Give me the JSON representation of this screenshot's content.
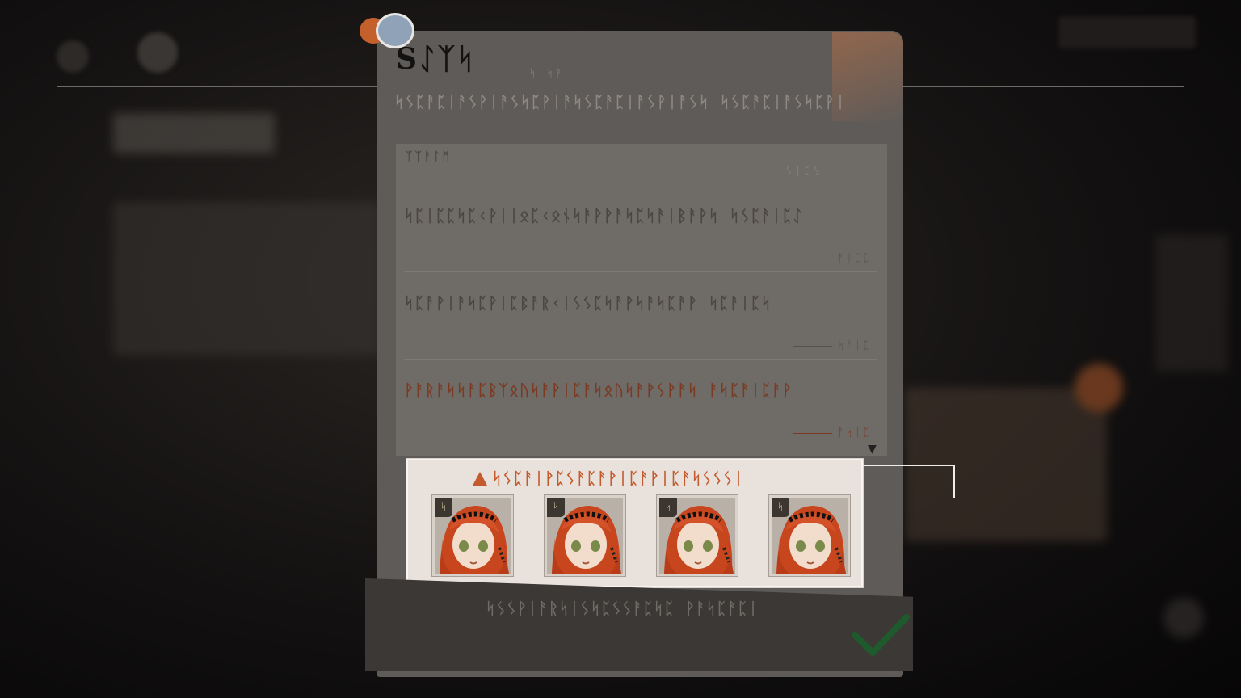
{
  "modal": {
    "title": "Sᛇᛉᛋ",
    "subtitle_tag": "ᛋᛁᛋᚹ",
    "description": "ᛋᛊᛈᚨᛈᛁᚨᛊᚹᛁᚨᛊᛋᛈᚹᛁᚨᛋᛊᛈᚨᛈᛁᚨᛊᚹᛁᚨᛊᛋ ᛋᛊᛈᚨᛈᛁᚨᛊᛋᛈᚹᛁ",
    "list_header": "ᛉᛉᚨᛚᛗ",
    "list_meta": "ᛊᛁᛈᛊ"
  },
  "missions": [
    {
      "text": "ᛋᛈᛁᛈᛈᛋᛈᚲᚹᛁᛁᛟᛈᚲᛟᚾᛋᚨᚹᚹᚨᛋᛈᛋᚨᛁᛒᚨᚹᛋ ᛋᛊᛈᚨᛁᛈᛇ",
      "progress": "ᚨᛁᛈᛈ",
      "highlight": false
    },
    {
      "text": "ᛋᛈᚨᚹᛁᚨᛋᛈᚹᛁᛈᛒᚨᚱᚲᛁᛊᛊᛈᛋᚨᚹᛋᚨᛋᛈᚨᚹ ᛋᛈᚨᛁᛈᛋ",
      "progress": "ᛋᚨᛁᛈ",
      "highlight": false
    },
    {
      "text": "ᚹᚨᚱᚨᛋᛋᚨᛈᛒᛉᛟᚢᛋᚨᚹᛁᛈᚨᛋᛟᚢᛋᚨᚹᛊᚹᚨᛋ ᚨᛋᛈᚨᛁᛈᚨᚹ",
      "progress": "ᚨᛋᛁᛈ",
      "highlight": true
    }
  ],
  "reward": {
    "title": "ᛋᛊᛈᚨᛁᚹᛈᛊᚨᛈᚨᚹᛁᛈᚨᚹᛁᛈᚨᛋᛊᛊᛊᛁ",
    "items": [
      {
        "name": "character-portrait",
        "lock": "ᛋ"
      },
      {
        "name": "character-portrait",
        "lock": "ᛋ"
      },
      {
        "name": "character-portrait",
        "lock": "ᛋ"
      },
      {
        "name": "character-portrait",
        "lock": "ᛋ"
      }
    ]
  },
  "confirm": {
    "text": "ᛋᛊᛊᚹᛁᚨᚱᛋᛁᛊᛋᛈᛊᛊᚨᛈᛋᛈ ᚹᚨᛋᛈᚨᛈᛁ",
    "icon": "checkmark-icon"
  },
  "colors": {
    "accent": "#c55a2e",
    "panel": "#e9e2dc",
    "modal": "#5f5b58"
  }
}
